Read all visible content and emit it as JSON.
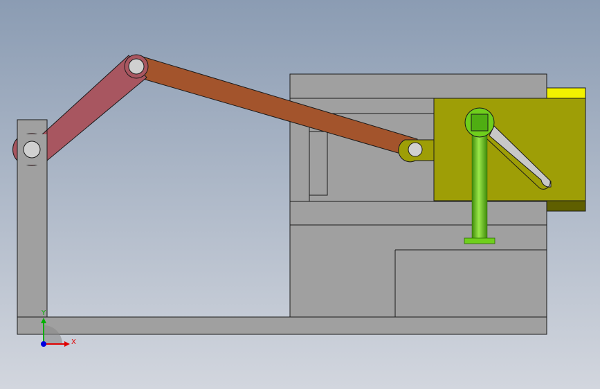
{
  "viewport": {
    "background_top": "#8b9cb3",
    "background_bottom": "#d2d6de"
  },
  "colors": {
    "frame": "#a0a0a0",
    "frame_edge": "#1a1a1a",
    "crank": "#a85660",
    "connecting_rod": "#a3542c",
    "slider_block": "#9e9e06",
    "slider_block_dark": "#5f5f00",
    "slider_top_strip": "#f2f200",
    "pin": "#6fcf1c",
    "pin_dark": "#3f8a0a",
    "pin_light": "#9ae84a",
    "hole": "#d0d0d0",
    "axis_x": "#e00000",
    "axis_y": "#00b000",
    "axis_z": "#0000e0"
  },
  "triad": {
    "x_label": "X",
    "y_label": "Y"
  },
  "parts": [
    {
      "name": "base-frame",
      "icon": "frame-part"
    },
    {
      "name": "crank-link",
      "icon": "link-part"
    },
    {
      "name": "connecting-rod",
      "icon": "link-part"
    },
    {
      "name": "slider-block",
      "icon": "block-part"
    },
    {
      "name": "guide-pin",
      "icon": "pin-part"
    }
  ]
}
